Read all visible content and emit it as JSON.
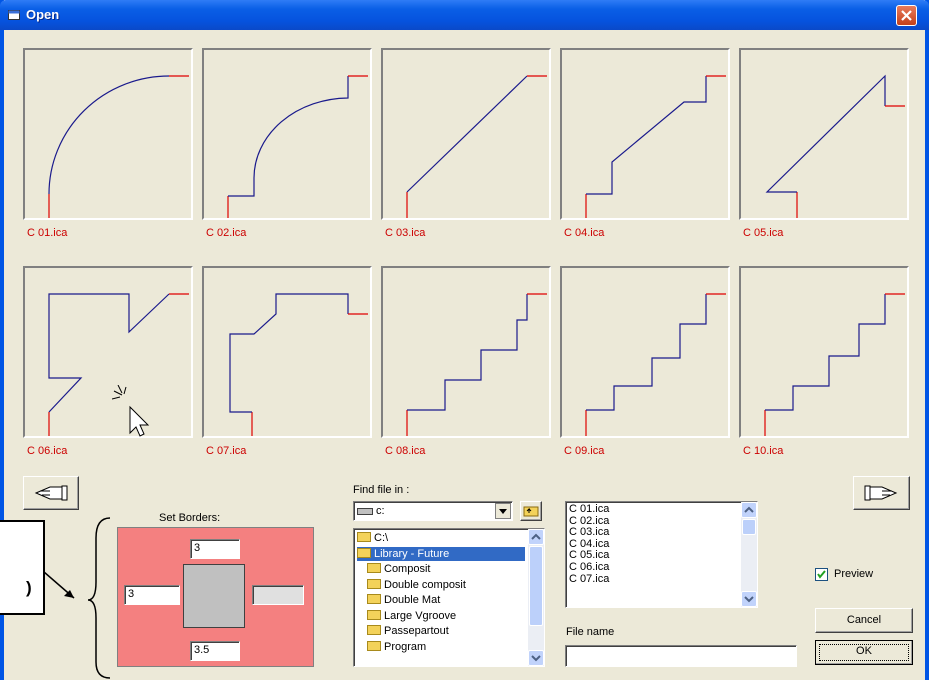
{
  "window": {
    "title": "Open"
  },
  "thumbnails": [
    {
      "label": "C 01.ica",
      "icon": "arc-profile-icon"
    },
    {
      "label": "C 02.ica",
      "icon": "step-arc-profile-icon"
    },
    {
      "label": "C 03.ica",
      "icon": "diagonal-profile-icon"
    },
    {
      "label": "C 04.ica",
      "icon": "step-diagonal-profile-icon"
    },
    {
      "label": "C 05.ica",
      "icon": "notched-diagonal-profile-icon"
    },
    {
      "label": "C 06.ica",
      "icon": "zigzag-profile-icon"
    },
    {
      "label": "C 07.ica",
      "icon": "stepped-box-profile-icon"
    },
    {
      "label": "C 08.ica",
      "icon": "stairs-4-profile-icon"
    },
    {
      "label": "C 09.ica",
      "icon": "stairs-5-profile-icon"
    },
    {
      "label": "C 10.ica",
      "icon": "stairs-5b-profile-icon"
    }
  ],
  "nav": {
    "prev_icon": "hand-pointing-left-icon",
    "next_icon": "hand-pointing-right-icon"
  },
  "borders": {
    "title": "Set Borders:",
    "top": "3",
    "left": "3",
    "right": "",
    "bottom": "3.5",
    "bg_color": "#f48080"
  },
  "find": {
    "label": "Find file in :",
    "drive": "c:",
    "tree": [
      {
        "label": "C:\\",
        "open": true,
        "selected": false,
        "indent": 0
      },
      {
        "label": "Library - Future",
        "open": true,
        "selected": true,
        "indent": 0
      },
      {
        "label": "Composit",
        "open": false,
        "selected": false,
        "indent": 1
      },
      {
        "label": "Double composit",
        "open": false,
        "selected": false,
        "indent": 1
      },
      {
        "label": "Double Mat",
        "open": false,
        "selected": false,
        "indent": 1
      },
      {
        "label": "Large Vgroove",
        "open": false,
        "selected": false,
        "indent": 1
      },
      {
        "label": "Passepartout",
        "open": false,
        "selected": false,
        "indent": 1
      },
      {
        "label": "Program",
        "open": false,
        "selected": false,
        "indent": 1
      }
    ]
  },
  "files": [
    "C 01.ica",
    "C 02.ica",
    "C 03.ica",
    "C 04.ica",
    "C 05.ica",
    "C 06.ica",
    "C 07.ica"
  ],
  "file_name": {
    "label": "File name",
    "value": ""
  },
  "preview": {
    "label": "Preview",
    "checked": true
  },
  "buttons": {
    "cancel": "Cancel",
    "ok": "OK"
  },
  "callout": {
    "text": ")"
  },
  "colors": {
    "title_blue": "#0a5fe6",
    "profile_line": "#1a1a8c",
    "profile_end": "#e00000",
    "selected_row": "#316ac5"
  }
}
